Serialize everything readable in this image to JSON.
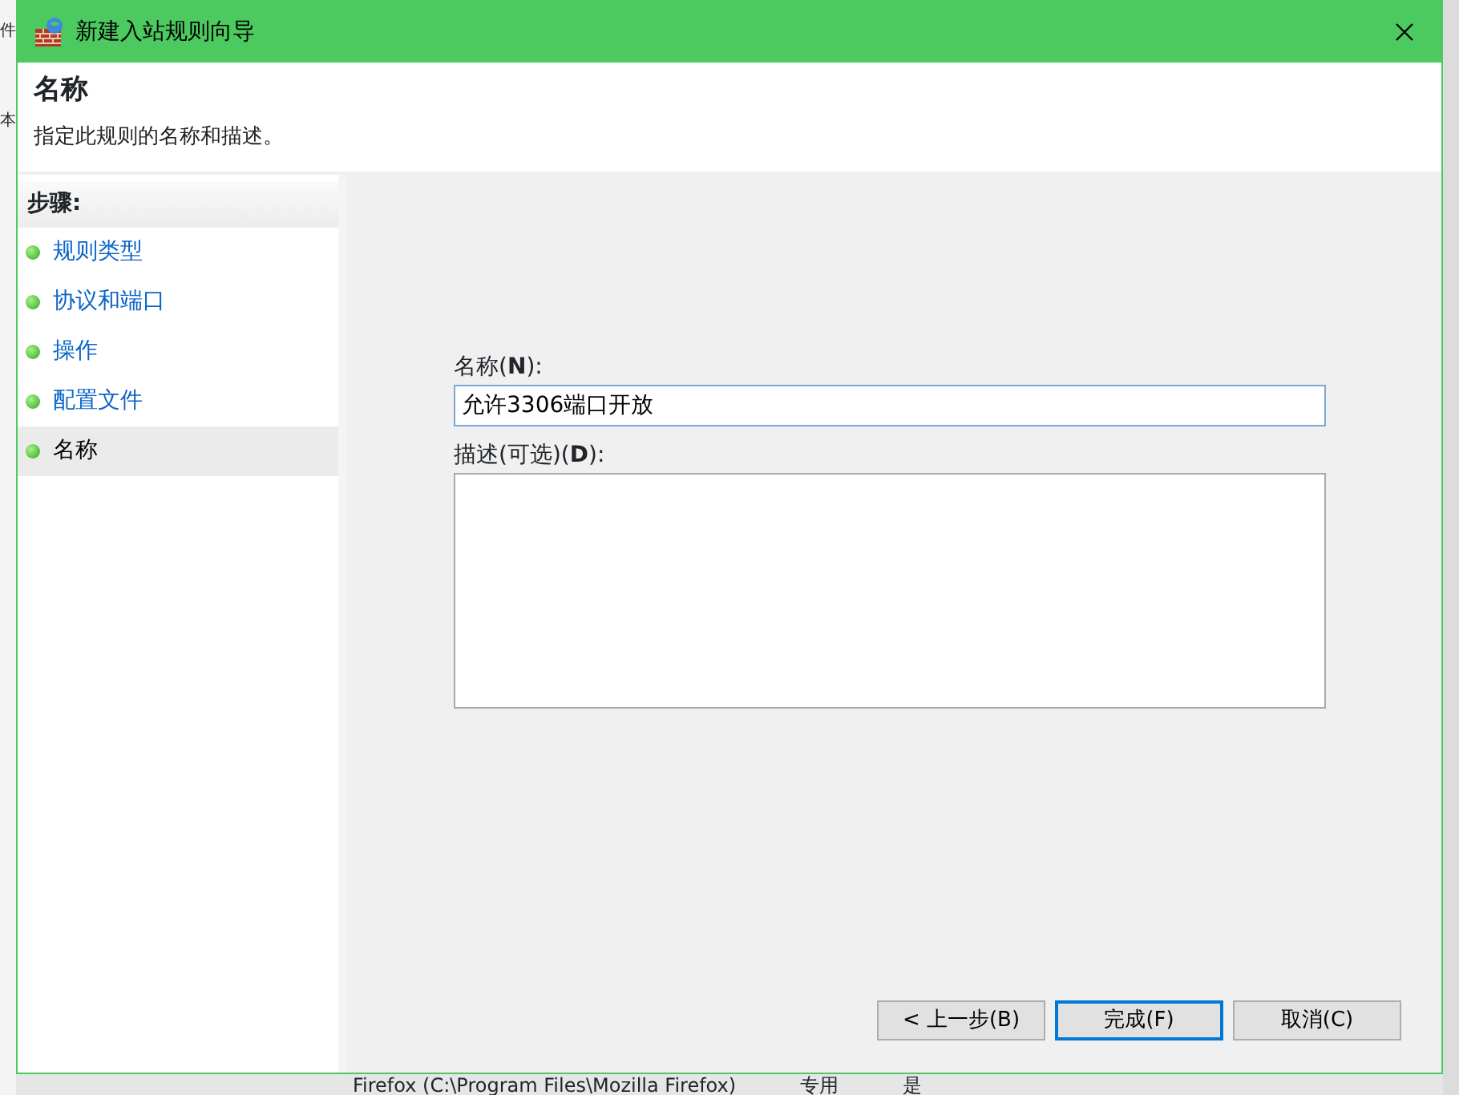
{
  "background_window": {
    "side_texts": [
      "件",
      "本"
    ],
    "bottom_row": {
      "name": "Firefox (C:\\Program Files\\Mozilla Firefox)",
      "profile": "专用",
      "enabled": "是"
    }
  },
  "window": {
    "title": "新建入站规则向导"
  },
  "header": {
    "title": "名称",
    "subtitle": "指定此规则的名称和描述。"
  },
  "steps": {
    "heading": "步骤:",
    "items": [
      {
        "label": "规则类型",
        "selected": false
      },
      {
        "label": "协议和端口",
        "selected": false
      },
      {
        "label": "操作",
        "selected": false
      },
      {
        "label": "配置文件",
        "selected": false
      },
      {
        "label": "名称",
        "selected": true
      }
    ]
  },
  "form": {
    "name_label": "名称(**N**):",
    "name_value": "允许3306端口开放",
    "description_label": "描述(可选)(**D**):"
  },
  "buttons": [
    {
      "label": "< 上一步(B)",
      "kind": "secondary"
    },
    {
      "label": "完成(F)",
      "kind": "default"
    },
    {
      "label": "取消(C)",
      "kind": "secondary"
    }
  ]
}
